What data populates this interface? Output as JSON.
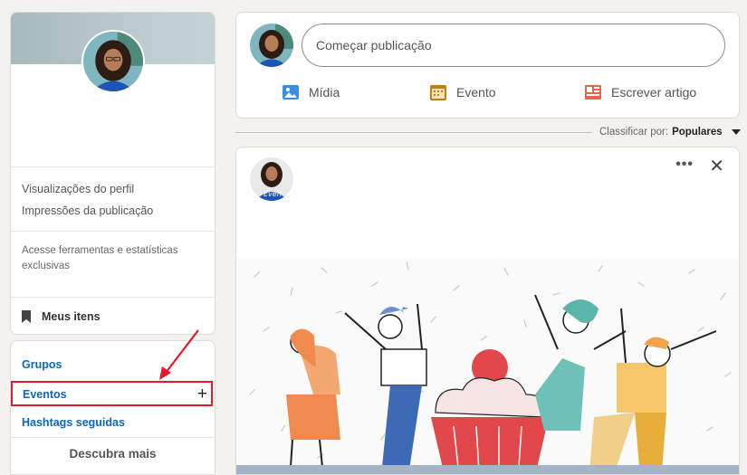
{
  "profile": {
    "stats": [
      "Visualizações do perfil",
      "Impressões da publicação"
    ],
    "promo": "Acesse ferramentas e estatísticas exclusivas",
    "saved": "Meus itens"
  },
  "nav": {
    "groups": "Grupos",
    "events": "Eventos",
    "hashtags": "Hashtags seguidas",
    "discover": "Descubra mais"
  },
  "share": {
    "placeholder": "Começar publicação",
    "actions": [
      "Mídia",
      "Evento",
      "Escrever artigo"
    ]
  },
  "sort": {
    "label": "Classificar por:",
    "value": "Populares"
  },
  "post": {
    "avatar_text": "Even"
  },
  "colors": {
    "link": "#0a66c2",
    "highlight": "#e5182c",
    "media_icon": "#378fe9",
    "event_icon": "#c37d16",
    "article_icon": "#e06847"
  }
}
